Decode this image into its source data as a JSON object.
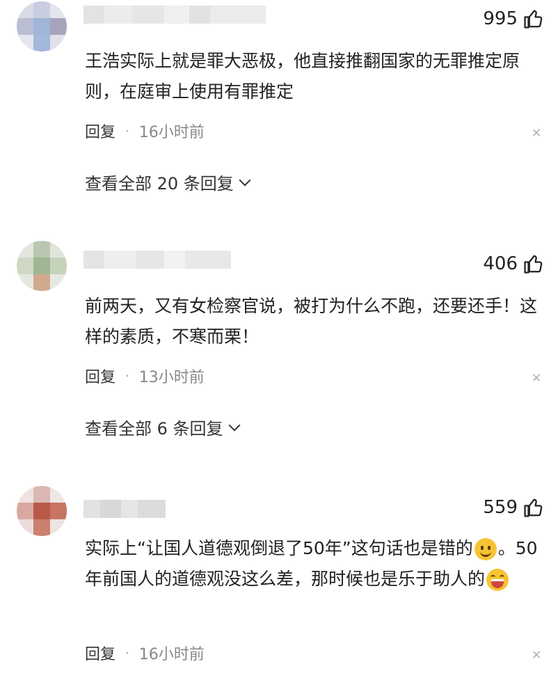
{
  "comments": [
    {
      "likes": "995",
      "text": "王浩实际上就是罪大恶极，他直接推翻国家的无罪推定原则，在庭审上使用有罪推定",
      "reply_label": "回复",
      "dot": "·",
      "time": "16小时前",
      "view_replies": "查看全部 20 条回复"
    },
    {
      "likes": "406",
      "text": "前两天，又有女检察官说，被打为什么不跑，还要还手！这样的素质，不寒而栗！",
      "reply_label": "回复",
      "dot": "·",
      "time": "13小时前",
      "view_replies": "查看全部 6 条回复"
    },
    {
      "likes": "559",
      "text_part1": "实际上“让国人道德观倒退了50年”这句话也是错的",
      "text_part2": "。50年前国人的道德观没这么差，那时候也是乐于助人的",
      "reply_label": "回复",
      "dot": "·",
      "time": "16小时前"
    }
  ],
  "icons": {
    "like": "thumbs-up-icon",
    "close": "close-icon",
    "chevron": "chevron-down-icon",
    "emoji_smile": "smile-emoji-icon",
    "emoji_laugh": "laugh-emoji-icon"
  },
  "close_glyph": "×"
}
